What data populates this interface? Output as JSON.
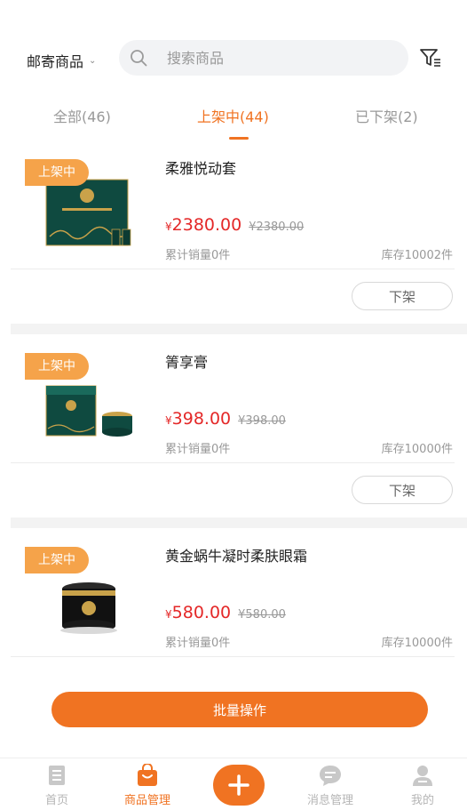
{
  "header": {
    "category_label": "邮寄商品",
    "search_placeholder": "搜索商品"
  },
  "tabs": [
    {
      "label": "全部(46)",
      "active": false
    },
    {
      "label": "上架中(44)",
      "active": true
    },
    {
      "label": "已下架(2)",
      "active": false
    }
  ],
  "products": [
    {
      "badge": "上架中",
      "name": "柔雅悦动套",
      "price_symbol": "¥",
      "price": "2380.00",
      "original_price": "¥2380.00",
      "sold": "累计销量0件",
      "stock": "库存10002件",
      "action": "下架"
    },
    {
      "badge": "上架中",
      "name": "箐享膏",
      "price_symbol": "¥",
      "price": "398.00",
      "original_price": "¥398.00",
      "sold": "累计销量0件",
      "stock": "库存10000件",
      "action": "下架"
    },
    {
      "badge": "上架中",
      "name": "黄金蜗牛凝时柔肤眼霜",
      "price_symbol": "¥",
      "price": "580.00",
      "original_price": "¥580.00",
      "sold": "累计销量0件",
      "stock": "库存10000件",
      "action": ""
    }
  ],
  "batch_button": "批量操作",
  "tabbar": [
    {
      "label": "首页",
      "icon": "home-icon",
      "active": false
    },
    {
      "label": "商品管理",
      "icon": "goods-bag-icon",
      "active": true
    },
    {
      "label": "",
      "icon": "plus-icon",
      "active": false
    },
    {
      "label": "消息管理",
      "icon": "message-icon",
      "active": false
    },
    {
      "label": "我的",
      "icon": "user-icon",
      "active": false
    }
  ],
  "colors": {
    "accent": "#f07322",
    "badge": "#f5a34a",
    "price": "#e42828"
  }
}
